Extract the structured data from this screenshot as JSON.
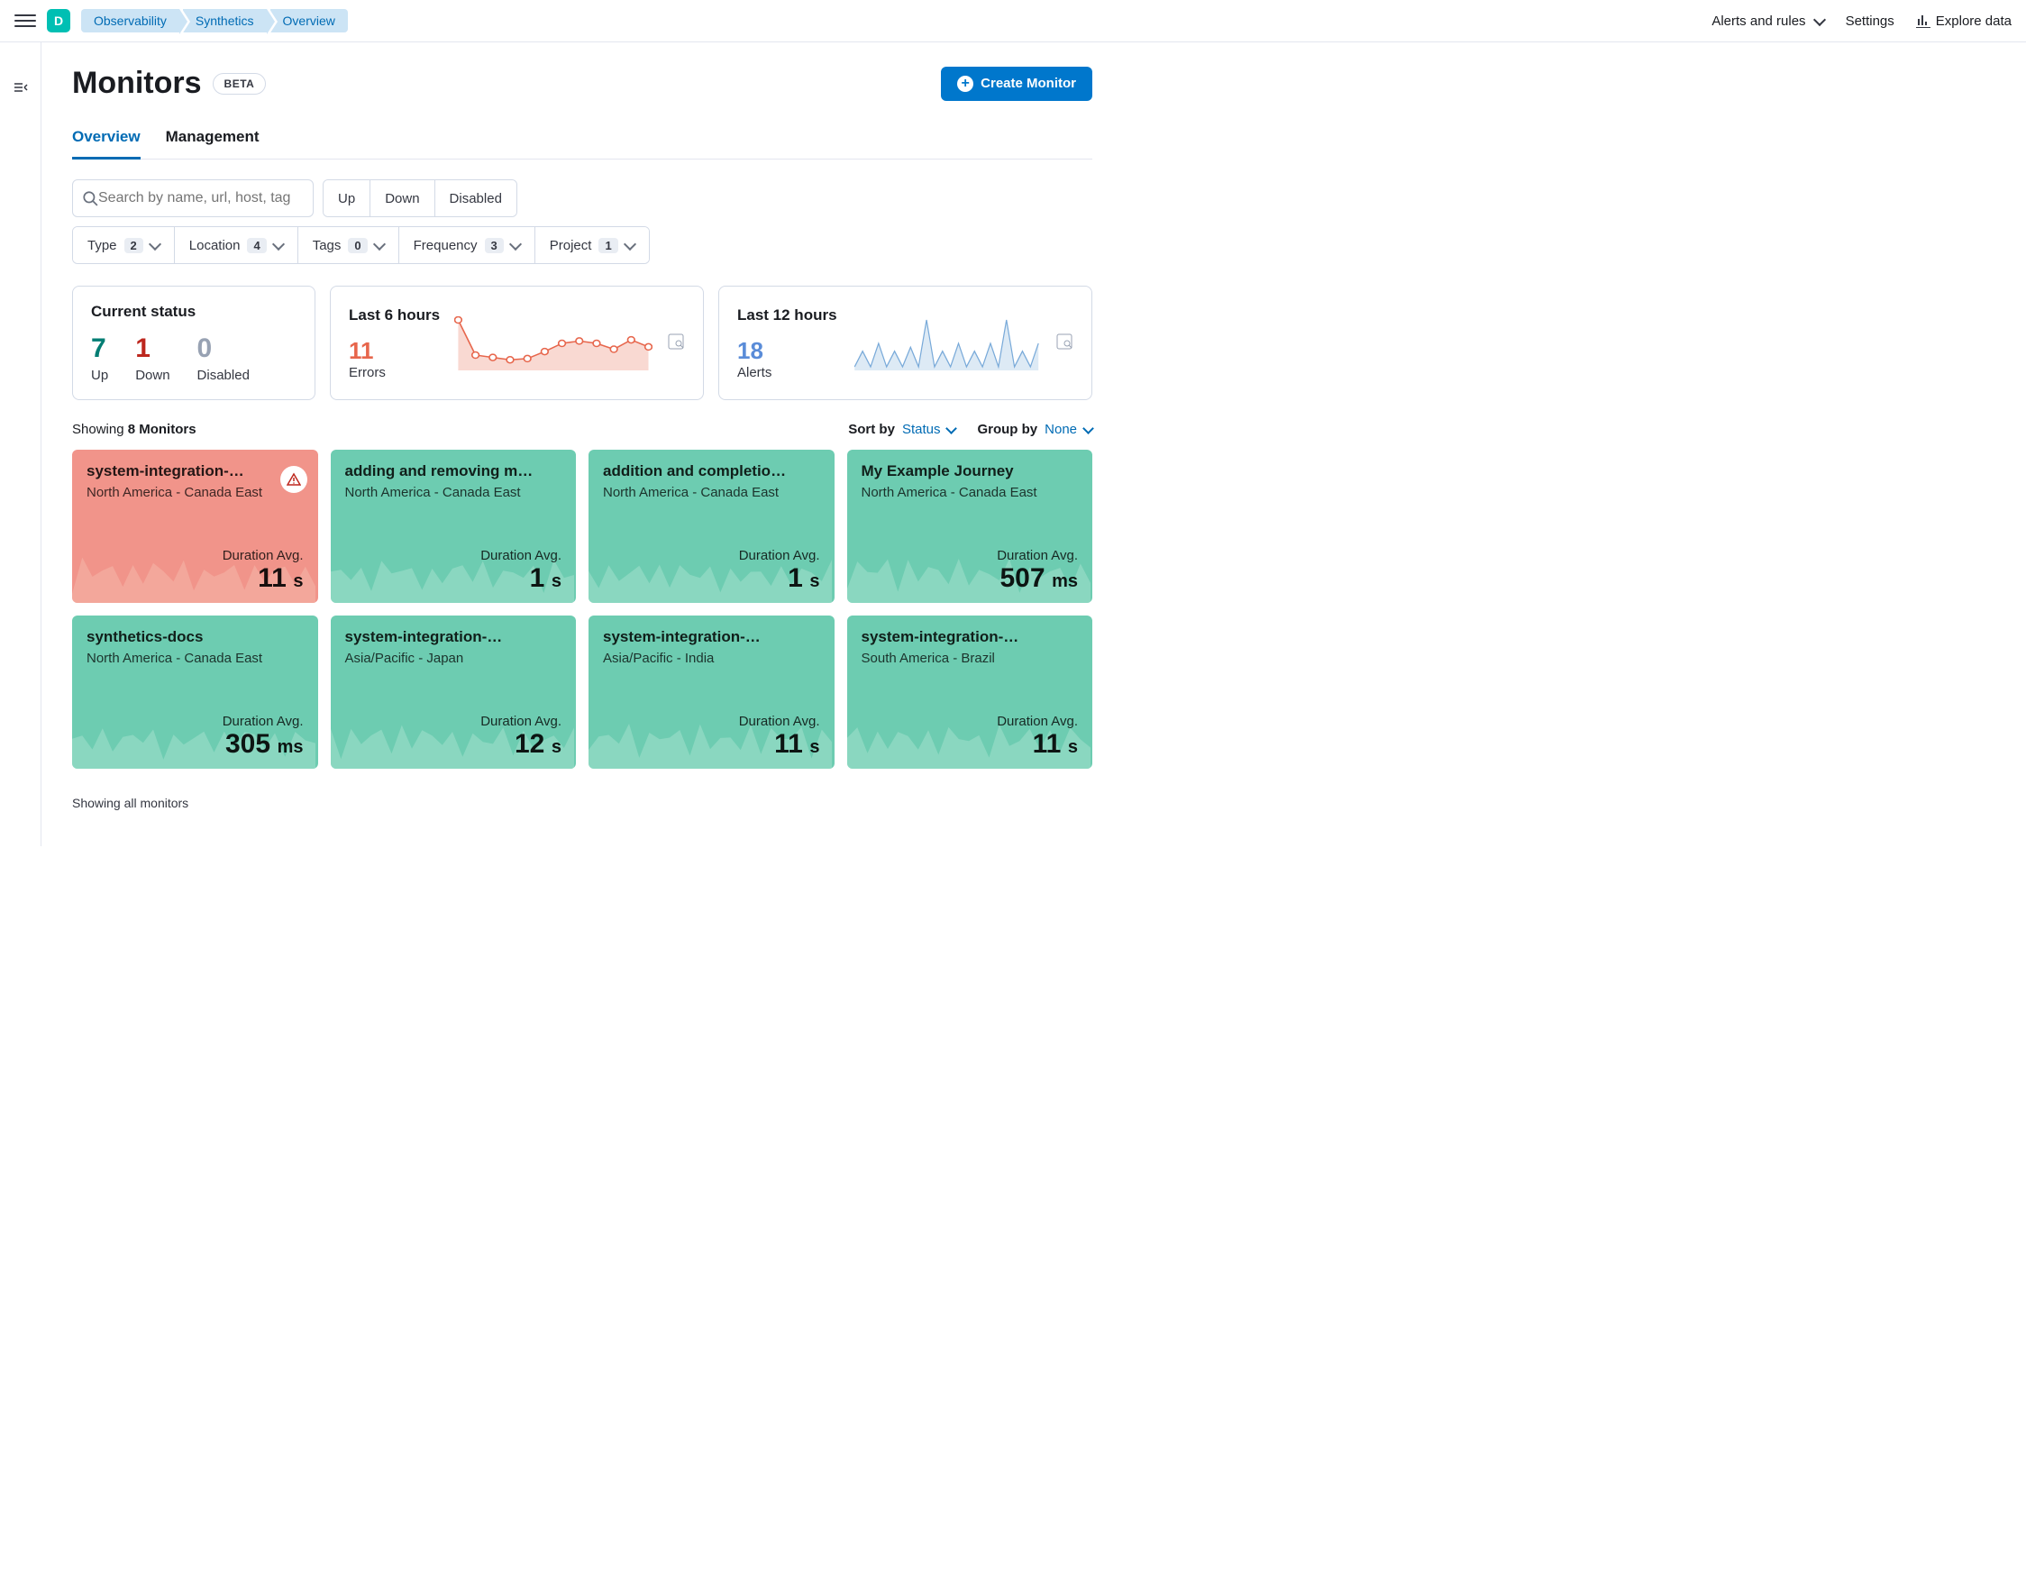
{
  "brand_letter": "D",
  "breadcrumbs": [
    "Observability",
    "Synthetics",
    "Overview"
  ],
  "topbar": {
    "alerts": "Alerts and rules",
    "settings": "Settings",
    "explore": "Explore data"
  },
  "page": {
    "title": "Monitors",
    "badge": "BETA",
    "create_btn": "Create Monitor"
  },
  "tabs": {
    "overview": "Overview",
    "management": "Management",
    "active": "overview"
  },
  "search": {
    "placeholder": "Search by name, url, host, tag"
  },
  "status_filters": {
    "up": "Up",
    "down": "Down",
    "disabled": "Disabled"
  },
  "facets": [
    {
      "label": "Type",
      "count": 2
    },
    {
      "label": "Location",
      "count": 4
    },
    {
      "label": "Tags",
      "count": 0
    },
    {
      "label": "Frequency",
      "count": 3
    },
    {
      "label": "Project",
      "count": 1
    }
  ],
  "summary": {
    "status_title": "Current status",
    "up": {
      "value": "7",
      "label": "Up"
    },
    "down": {
      "value": "1",
      "label": "Down"
    },
    "disabled": {
      "value": "0",
      "label": "Disabled"
    },
    "errors": {
      "title": "Last 6 hours",
      "value": "11",
      "label": "Errors"
    },
    "alerts": {
      "title": "Last 12 hours",
      "value": "18",
      "label": "Alerts"
    }
  },
  "showing": {
    "prefix": "Showing ",
    "count": "8 Monitors"
  },
  "sort": {
    "label": "Sort by",
    "value": "Status"
  },
  "group": {
    "label": "Group by",
    "value": "None"
  },
  "duration_label": "Duration Avg.",
  "cards": [
    {
      "title": "system-integration-…",
      "location": "North America - Canada East",
      "value": "11",
      "unit": "s",
      "status": "err",
      "warn": true
    },
    {
      "title": "adding and removing multiple tasks",
      "location": "North America - Canada East",
      "value": "1",
      "unit": "s",
      "status": "ok"
    },
    {
      "title": "addition and completion of single task",
      "location": "North America - Canada East",
      "value": "1",
      "unit": "s",
      "status": "ok"
    },
    {
      "title": "My Example Journey",
      "location": "North America - Canada East",
      "value": "507",
      "unit": "ms",
      "status": "ok"
    },
    {
      "title": "synthetics-docs",
      "location": "North America - Canada East",
      "value": "305",
      "unit": "ms",
      "status": "ok"
    },
    {
      "title": "system-integration-…",
      "location": "Asia/Pacific - Japan",
      "value": "12",
      "unit": "s",
      "status": "ok"
    },
    {
      "title": "system-integration-…",
      "location": "Asia/Pacific - India",
      "value": "11",
      "unit": "s",
      "status": "ok"
    },
    {
      "title": "system-integration-…",
      "location": "South America - Brazil",
      "value": "11",
      "unit": "s",
      "status": "ok"
    }
  ],
  "footer_text": "Showing all monitors",
  "chart_data": [
    {
      "type": "line",
      "title": "Last 6 hours — Errors",
      "x": [
        0,
        1,
        2,
        3,
        4,
        5,
        6,
        7,
        8,
        9,
        10,
        11
      ],
      "values": [
        4,
        1,
        0.8,
        0.6,
        0.7,
        1.3,
        2,
        2.2,
        2,
        1.5,
        2.3,
        1.7
      ],
      "ylim": [
        0,
        4
      ],
      "color": "#e7664c",
      "markers": true,
      "fill": true
    },
    {
      "type": "line",
      "title": "Last 12 hours — Alerts",
      "x": [
        0,
        1,
        2,
        3,
        4,
        5,
        6,
        7,
        8,
        9,
        10,
        11,
        12,
        13,
        14,
        15,
        16,
        17,
        18,
        19,
        20,
        21,
        22,
        23
      ],
      "values": [
        0,
        2,
        0,
        3,
        0,
        2,
        0,
        2.5,
        0,
        6,
        0,
        2,
        0,
        3,
        0,
        2,
        0,
        3,
        0,
        6,
        0,
        2,
        0,
        3
      ],
      "ylim": [
        0,
        6
      ],
      "color": "#79aad9",
      "markers": false,
      "fill": true
    }
  ]
}
